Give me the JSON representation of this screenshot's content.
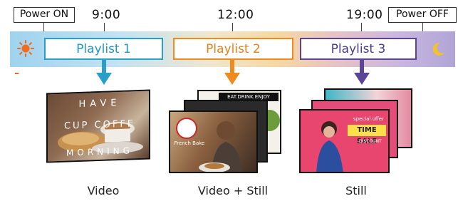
{
  "power_on_label": "Power ON",
  "power_off_label": "Power OFF",
  "times": [
    "9:00",
    "12:00",
    "19:00"
  ],
  "playlists": [
    {
      "label": "Playlist 1",
      "color": "#2aa0c8",
      "caption": "Video"
    },
    {
      "label": "Playlist 2",
      "color": "#ee8a1e",
      "caption": "Video + Still"
    },
    {
      "label": "Playlist 3",
      "color": "#5a4596",
      "caption": "Still"
    }
  ],
  "icons": {
    "start": "sun-icon",
    "end": "moon-icon"
  },
  "screen_text": {
    "coffee_line1": "HAVE",
    "coffee_line2": "CUP COFFE",
    "coffee_line3": "MORNING",
    "menu_header": "EAT.DRINK.ENJOY",
    "food_logo": "French Bake",
    "sale_line1": "special offer",
    "sale_line2": "TIME SALE",
    "sale_line3": "DISCOUNT"
  }
}
